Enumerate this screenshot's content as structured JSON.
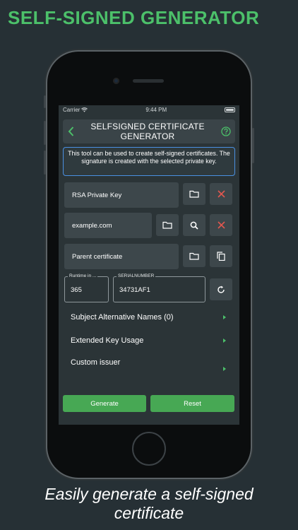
{
  "promo": {
    "headline": "SELF-SIGNED GENERATOR",
    "caption_line1": "Easily generate a self-signed",
    "caption_line2": "certificate"
  },
  "status_bar": {
    "carrier": "Carrier",
    "time": "9:44 PM"
  },
  "navbar": {
    "title_line1": "SELFSIGNED CERTIFICATE",
    "title_line2": "GENERATOR",
    "back_icon": "chevron-left-icon",
    "help_icon": "question-circle-icon"
  },
  "info_text": "This tool can be used to create self-signed certificates. The signature is created with the selected private key.",
  "fields": {
    "private_key": "RSA Private Key",
    "common_name": "example.com",
    "parent_certificate": "Parent certificate"
  },
  "runtime": {
    "label": "Runtime in ...",
    "value": "365"
  },
  "serial": {
    "label": "SERIALNUMBER",
    "value": "34731AF1"
  },
  "options": [
    {
      "label": "Subject Alternative Names (0)"
    },
    {
      "label": "Extended Key Usage"
    },
    {
      "label": "Custom issuer"
    }
  ],
  "buttons": {
    "generate": "Generate",
    "reset": "Reset"
  },
  "colors": {
    "accent_green": "#4cc06a",
    "danger_red": "#e0574f",
    "info_border": "#4a90e2",
    "background": "#263035"
  }
}
